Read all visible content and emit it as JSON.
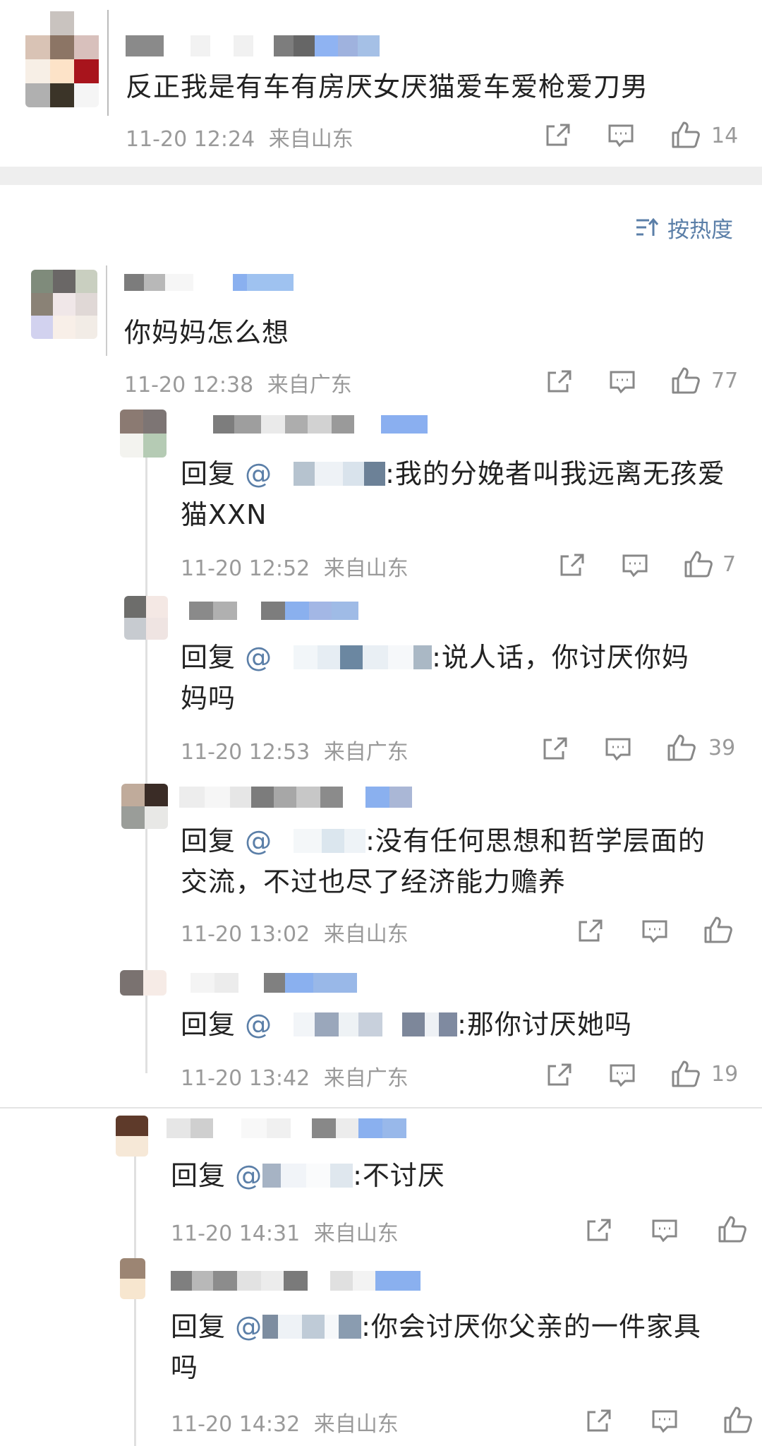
{
  "sort": {
    "icon": "sort-icon",
    "label": "按热度"
  },
  "main_comment": {
    "text": "反正我是有车有房厌女厌猫爱车爱枪爱刀男",
    "time": "11-20 12:24",
    "location": "来自山东",
    "likes": "14"
  },
  "comment": {
    "text": "你妈妈怎么想",
    "time": "11-20 12:38",
    "location": "来自广东",
    "likes": "77"
  },
  "replies": [
    {
      "prefix": "回复",
      "at": "@",
      "text": ":我的分娩者叫我远离无孩爱猫XXN",
      "line1": ":我的分娩者叫我远离无孩爱",
      "line2": "猫XXN",
      "time": "11-20 12:52",
      "location": "来自山东",
      "likes": "7"
    },
    {
      "prefix": "回复",
      "at": "@",
      "line1": ":说人话，你讨厌你妈",
      "line2": "妈吗",
      "time": "11-20 12:53",
      "location": "来自广东",
      "likes": "39"
    },
    {
      "prefix": "回复",
      "at": "@",
      "line1": ":没有任何思想和哲学层面的",
      "line2": "交流，不过也尽了经济能力赡养",
      "time": "11-20 13:02",
      "location": "来自山东",
      "likes": ""
    },
    {
      "prefix": "回复",
      "at": "@",
      "line1": ":那你讨厌她吗",
      "time": "11-20 13:42",
      "location": "来自广东",
      "likes": "19"
    },
    {
      "prefix": "回复",
      "at": "@",
      "line1": ":不讨厌",
      "time": "11-20 14:31",
      "location": "来自山东",
      "likes": ""
    },
    {
      "prefix": "回复",
      "at": "@",
      "line1": ":你会讨厌你父亲的一件家具",
      "line2": "吗",
      "time": "11-20 14:32",
      "location": "来自山东",
      "likes": ""
    }
  ],
  "icons": {
    "share": "share-icon",
    "comment": "comment-icon",
    "like": "thumbs-up-icon"
  },
  "colors": {
    "link": "#5b7fa8",
    "meta": "#9a9a9a",
    "text": "#222222",
    "separator": "#eeeeee"
  }
}
